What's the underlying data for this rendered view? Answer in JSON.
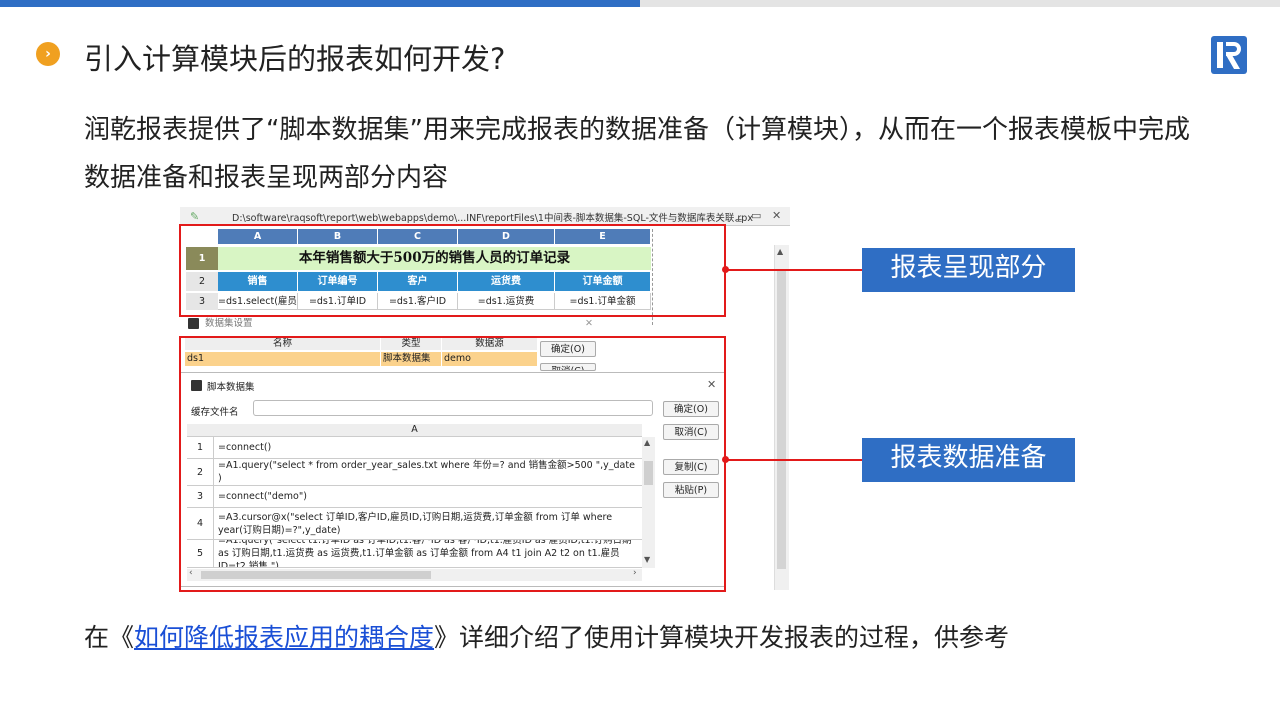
{
  "header": {
    "bullet_icon": "chevron-right-icon",
    "bullet_glyph": "›",
    "title": "引入计算模块后的报表如何开发?",
    "accent_color": "#2f6ec4"
  },
  "body": {
    "paragraph": "润乾报表提供了“脚本数据集”用来完成报表的数据准备（计算模块），从而在一个报表模板中完成数据准备和报表呈现两部分内容",
    "footer_prefix": "在《",
    "footer_link": "如何降低报表应用的耦合度",
    "footer_suffix": "》详细介绍了使用计算模块开发报表的过程，供参考"
  },
  "callouts": {
    "report_display": "报表呈现部分",
    "data_prep": "报表数据准备"
  },
  "window": {
    "path": "D:\\software\\raqsoft\\report\\web\\webapps\\demo\\...INF\\reportFiles\\1中间表-脚本数据集-SQL-文件与数据库表关联.rpx",
    "minimize": "‗",
    "restore": "▭",
    "close": "✕"
  },
  "sheet": {
    "columns": [
      "A",
      "B",
      "C",
      "D",
      "E"
    ],
    "row_numbers": [
      "1",
      "2",
      "3"
    ],
    "title": "本年销售额大于500万的销售人员的订单记录",
    "headers": [
      "销售",
      "订单编号",
      "客户",
      "运货费",
      "订单金额"
    ],
    "values": [
      "=ds1.select(雇员",
      "=ds1.订单ID",
      "=ds1.客户ID",
      "=ds1.运货费",
      "=ds1.订单金额"
    ]
  },
  "dataset_dialog": {
    "title": "数据集设置",
    "close": "✕",
    "col_name": "名称",
    "col_type": "类型",
    "col_source": "数据源",
    "row_name": "ds1",
    "row_type": "脚本数据集",
    "row_source": "demo",
    "ok": "确定(O)",
    "cancel": "取消(C)"
  },
  "script_dialog": {
    "title": "脚本数据集",
    "close": "✕",
    "cache_label": "缓存文件名",
    "cache_value": "",
    "col_a": "A",
    "ok": "确定(O)",
    "cancel": "取消(C)",
    "copy": "复制(C)",
    "paste": "粘贴(P)",
    "rows": [
      {
        "n": "1",
        "code": "=connect()"
      },
      {
        "n": "2",
        "code": "=A1.query(\"select * from order_year_sales.txt where 年份=? and 销售金额>500 \",y_date )"
      },
      {
        "n": "3",
        "code": "=connect(\"demo\")"
      },
      {
        "n": "4",
        "code": "=A3.cursor@x(\"select 订单ID,客户ID,雇员ID,订购日期,运货费,订单金额 from 订单 where year(订购日期)=?\",y_date)"
      },
      {
        "n": "5",
        "code": "=A1.query(\"select t1.订单ID as 订单ID,t1.客户ID as 客户ID,t1.雇员ID as 雇员ID,t1.订购日期 as 订购日期,t1.运货费 as 运货费,t1.订单金额 as 订单金额 from A4 t1 join A2 t2 on t1.雇员ID=t2.销售 \")"
      }
    ]
  }
}
